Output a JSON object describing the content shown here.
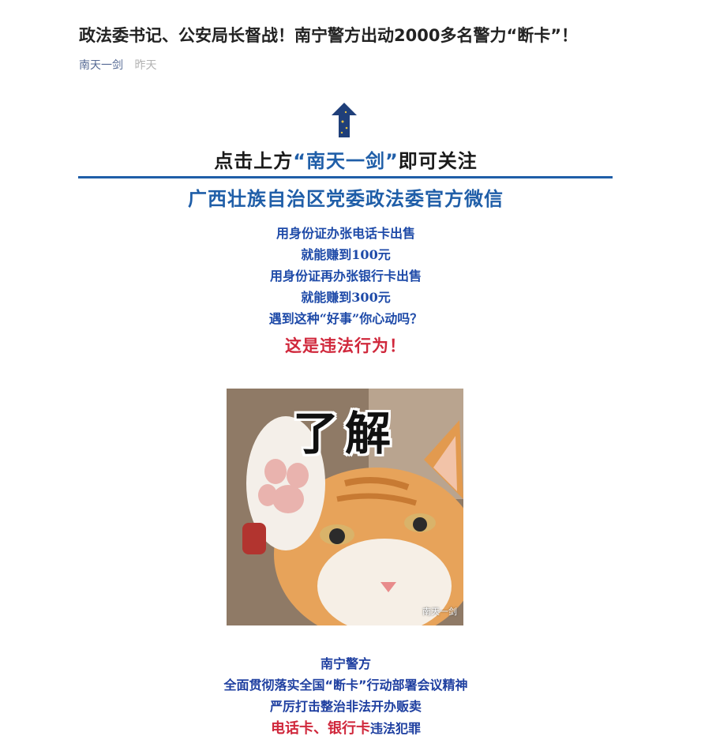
{
  "article": {
    "title": "政法委书记、公安局长督战！南宁警方出动2000多名警力“断卡”！",
    "author": "南天一剑",
    "date": "昨天"
  },
  "banner": {
    "follow_prefix": "点击上方",
    "follow_account": "“南天一剑”",
    "follow_suffix": "即可关注",
    "official": "广西壮族自治区党委政法委官方微信",
    "accent_color": "#1f5ea8",
    "arrow_icon": "up-arrow-icon"
  },
  "intro": {
    "lines": [
      "用身份证办张电话卡出售",
      "就能赚到100元",
      "用身份证再办张银行卡出售",
      "就能赚到300元",
      "遇到这种“好事”你心动吗？"
    ],
    "warning": "这是违法行为！",
    "warning_color": "#d0283c"
  },
  "meme": {
    "caption": "了解",
    "watermark": "南天一剑"
  },
  "closing": {
    "line1": "南宁警方",
    "line2": "全面贯彻落实全国“断卡”行动部署会议精神",
    "line3": "严厉打击整治非法开办贩卖",
    "line4_red": "电话卡、银行卡",
    "line4_blue": "违法犯罪"
  }
}
